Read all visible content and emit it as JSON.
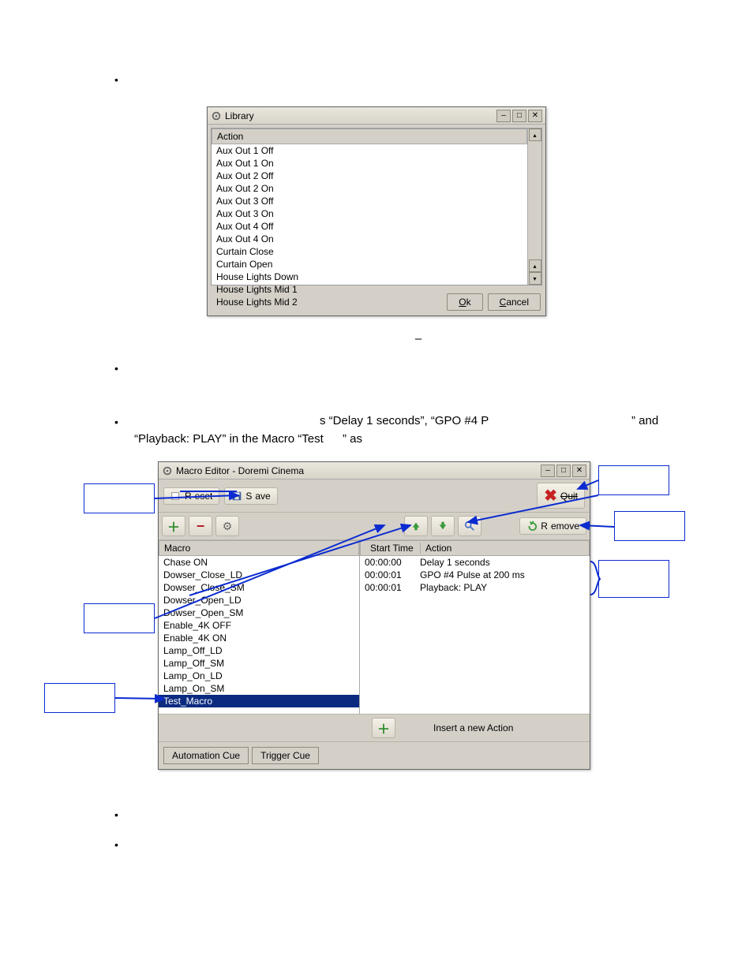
{
  "bullets": {
    "b1": "•",
    "b2": "•",
    "b3_prefix": "•",
    "b3_text1": "s “Delay 1 seconds”, “GPO #4 P",
    "b3_text2": "” and",
    "b3_line2a": "“Playback: PLAY” in the Macro “Test",
    "b3_line2b": "” as",
    "b4": "•",
    "b5": "•"
  },
  "figure_caption": "–",
  "library_window": {
    "title": "Library",
    "header": "Action",
    "items": [
      "Aux Out 1 Off",
      "Aux Out 1 On",
      "Aux Out 2 Off",
      "Aux Out 2 On",
      "Aux Out 3 Off",
      "Aux Out 3 On",
      "Aux Out 4 Off",
      "Aux Out 4 On",
      "Curtain Close",
      "Curtain Open",
      "House Lights Down",
      "House Lights Mid 1",
      "House Lights Mid 2"
    ],
    "ok": "Ok",
    "cancel": "Cancel"
  },
  "macro_window": {
    "title": "Macro Editor - Doremi Cinema",
    "reset_label": "Reset",
    "save_label": "Save",
    "quit_label": "Quit",
    "remove_label": "Remove",
    "macro_header": "Macro",
    "start_time_header": "Start Time",
    "action_header": "Action",
    "macros": [
      "Chase ON",
      "Dowser_Close_LD",
      "Dowser_Close_SM",
      "Dowser_Open_LD",
      "Dowser_Open_SM",
      "Enable_4K OFF",
      "Enable_4K ON",
      "Lamp_Off_LD",
      "Lamp_Off_SM",
      "Lamp_On_LD",
      "Lamp_On_SM",
      "Test_Macro"
    ],
    "selected_macro_index": 11,
    "actions": [
      {
        "start": "00:00:00",
        "action": "Delay 1 seconds"
      },
      {
        "start": "00:00:01",
        "action": "GPO #4 Pulse at 200 ms"
      },
      {
        "start": "00:00:01",
        "action": "Playback: PLAY"
      }
    ],
    "insert_action_label": "Insert a new Action",
    "tab_automation": "Automation Cue",
    "tab_trigger": "Trigger Cue"
  },
  "callouts": {
    "save": "",
    "quit": "",
    "remove": "",
    "select_action": "",
    "move_up_down": "",
    "macro_name": ""
  }
}
